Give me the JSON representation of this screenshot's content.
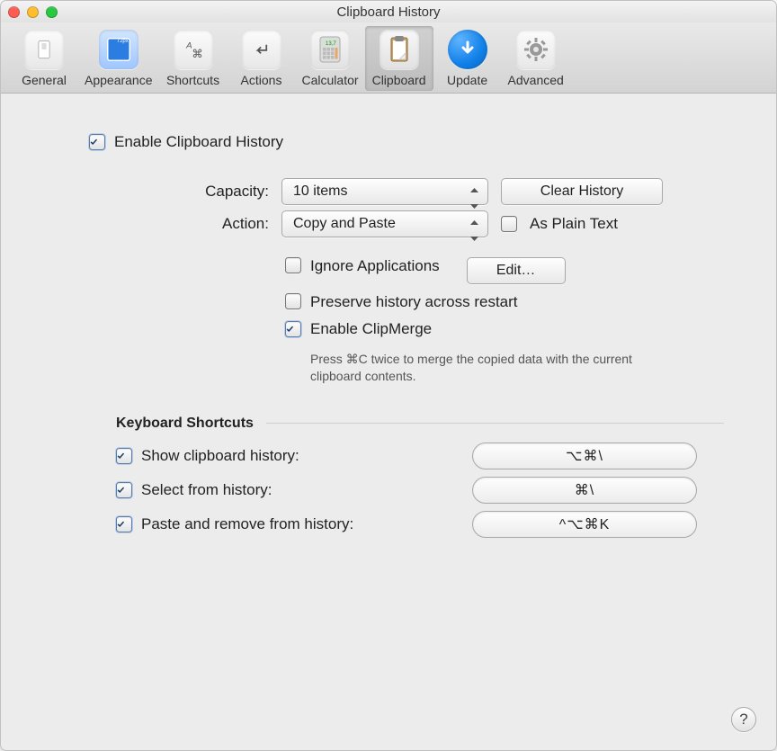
{
  "window": {
    "title": "Clipboard History"
  },
  "toolbar": {
    "items": [
      {
        "id": "general",
        "label": "General"
      },
      {
        "id": "appearance",
        "label": "Appearance"
      },
      {
        "id": "shortcuts",
        "label": "Shortcuts"
      },
      {
        "id": "actions",
        "label": "Actions"
      },
      {
        "id": "calculator",
        "label": "Calculator"
      },
      {
        "id": "clipboard",
        "label": "Clipboard",
        "selected": true
      },
      {
        "id": "update",
        "label": "Update"
      },
      {
        "id": "advanced",
        "label": "Advanced"
      }
    ]
  },
  "enable": {
    "checked": true,
    "label": "Enable Clipboard History"
  },
  "capacity": {
    "label": "Capacity:",
    "value": "10 items",
    "clear_btn": "Clear History"
  },
  "action": {
    "label": "Action:",
    "value": "Copy and Paste",
    "as_plain": {
      "checked": false,
      "label": "As Plain Text"
    }
  },
  "options": {
    "ignore_apps": {
      "checked": false,
      "label": "Ignore Applications",
      "edit_btn": "Edit…"
    },
    "preserve": {
      "checked": false,
      "label": "Preserve history across restart"
    },
    "clipmerge": {
      "checked": true,
      "label": "Enable ClipMerge",
      "hint": "Press ⌘C twice to merge the copied data with the current clipboard contents."
    }
  },
  "shortcuts_section": {
    "title": "Keyboard Shortcuts",
    "rows": [
      {
        "checked": true,
        "label": "Show clipboard history:",
        "keys": "⌥⌘\\"
      },
      {
        "checked": true,
        "label": "Select from history:",
        "keys": "⌘\\"
      },
      {
        "checked": true,
        "label": "Paste and remove from history:",
        "keys": "^⌥⌘K"
      }
    ]
  },
  "help_btn": "?"
}
